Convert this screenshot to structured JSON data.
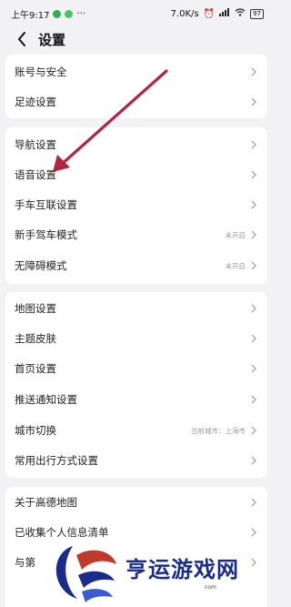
{
  "status_bar": {
    "time": "上午9:17",
    "net_speed": "7.0K/s",
    "battery": "97"
  },
  "header": {
    "title": "设置"
  },
  "groups": [
    {
      "items": [
        {
          "label": "账号与安全",
          "value": ""
        },
        {
          "label": "足迹设置",
          "value": ""
        }
      ]
    },
    {
      "items": [
        {
          "label": "导航设置",
          "value": ""
        },
        {
          "label": "语音设置",
          "value": ""
        },
        {
          "label": "手车互联设置",
          "value": ""
        },
        {
          "label": "新手驾车模式",
          "value": "未开启"
        },
        {
          "label": "无障碍模式",
          "value": "未开启"
        }
      ]
    },
    {
      "items": [
        {
          "label": "地图设置",
          "value": ""
        },
        {
          "label": "主题皮肤",
          "value": ""
        },
        {
          "label": "首页设置",
          "value": ""
        },
        {
          "label": "推送通知设置",
          "value": ""
        },
        {
          "label": "城市切换",
          "value": "当前城市：上海市"
        },
        {
          "label": "常用出行方式设置",
          "value": ""
        }
      ]
    },
    {
      "items": [
        {
          "label": "关于高德地图",
          "value": ""
        },
        {
          "label": "已收集个人信息清单",
          "value": ""
        },
        {
          "label": "与第",
          "value": ""
        }
      ]
    }
  ],
  "watermark": {
    "text": "亨运游戏网",
    "sub": "com"
  },
  "colors": {
    "annotation_arrow": "#b2253f",
    "brand": "#1b2b8c"
  }
}
